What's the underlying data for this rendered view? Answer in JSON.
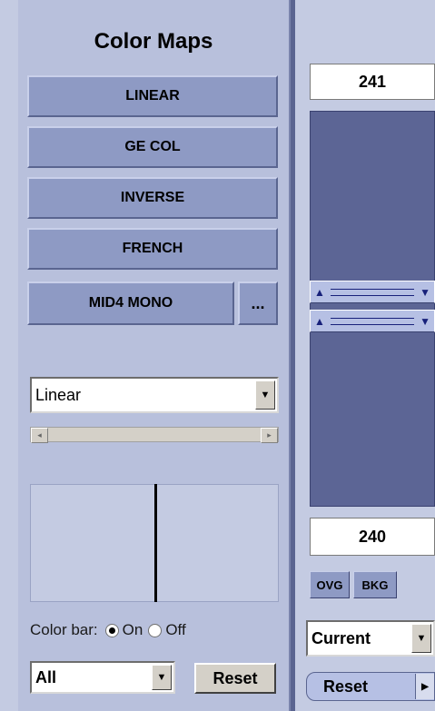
{
  "title": "Color Maps",
  "colormap_buttons": [
    "LINEAR",
    "GE COL",
    "INVERSE",
    "FRENCH",
    "MID4 MONO"
  ],
  "more_button": "...",
  "map_select": {
    "value": "Linear",
    "arrow": "▼"
  },
  "colorbar": {
    "label": "Color bar:",
    "on": "On",
    "off": "Off",
    "selected": "On"
  },
  "scope_select": {
    "value": "All",
    "arrow": "▼"
  },
  "left_reset": "Reset",
  "range": {
    "upper": "241",
    "lower": "240"
  },
  "window_buttons": [
    "OVG",
    "BKG"
  ],
  "mode_select": {
    "value": "Current",
    "arrow": "▼"
  },
  "right_reset": "Reset",
  "icons": {
    "scroll_left": "◂",
    "scroll_right": "▸",
    "handle_up": "▲",
    "handle_down": "▼",
    "reset_arrow": "▶"
  }
}
